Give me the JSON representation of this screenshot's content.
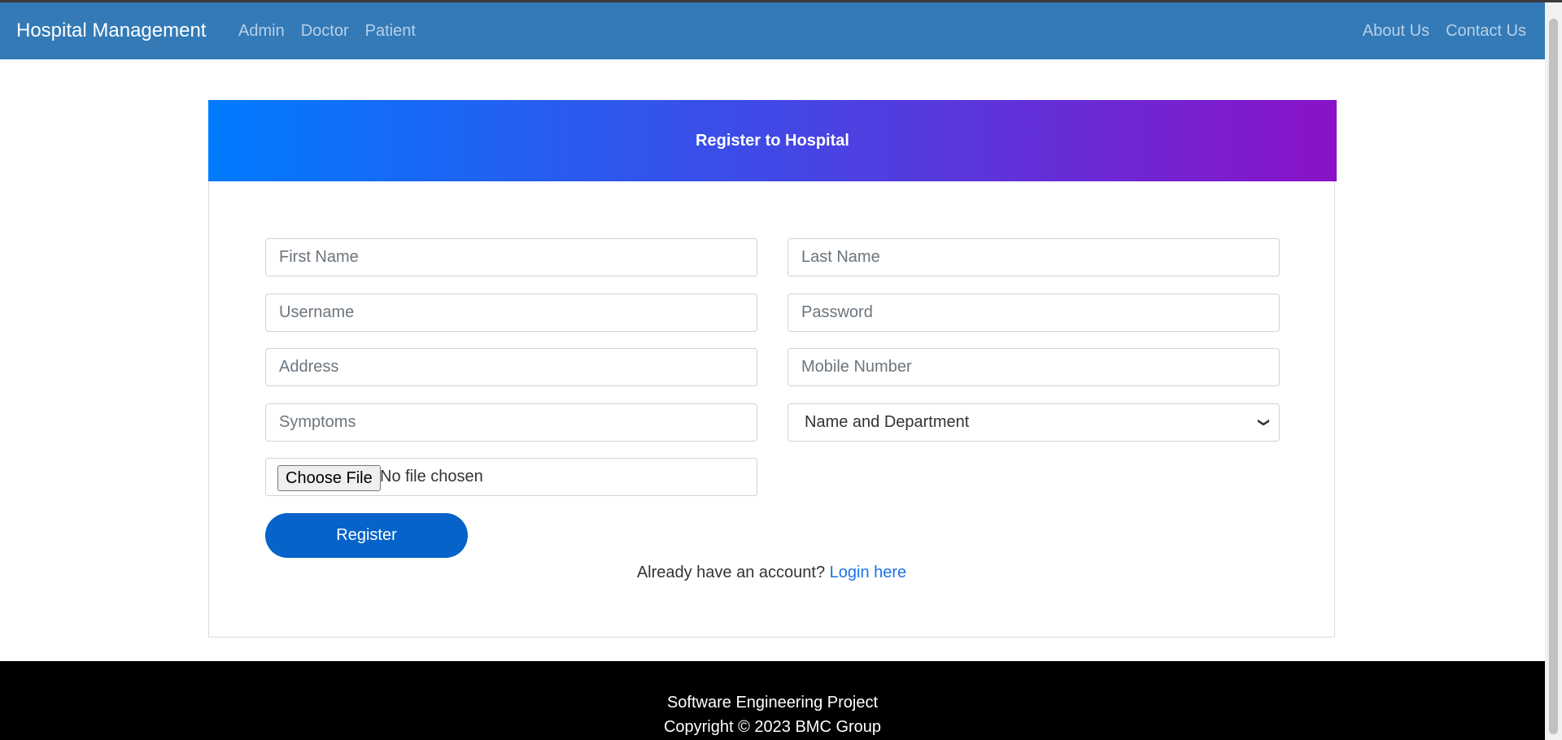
{
  "navbar": {
    "brand": "Hospital Management",
    "left_links": [
      "Admin",
      "Doctor",
      "Patient"
    ],
    "right_links": [
      "About Us",
      "Contact Us"
    ]
  },
  "form": {
    "title": "Register to Hospital",
    "first_name_placeholder": "First Name",
    "last_name_placeholder": "Last Name",
    "username_placeholder": "Username",
    "password_placeholder": "Password",
    "address_placeholder": "Address",
    "mobile_placeholder": "Mobile Number",
    "symptoms_placeholder": "Symptoms",
    "doctor_select_value": "Name and Department",
    "file_button_label": "Choose File",
    "file_status": "No file chosen",
    "register_label": "Register",
    "account_prompt": "Already have an account?",
    "login_link": "Login here"
  },
  "footer": {
    "line1": "Software Engineering Project",
    "line2": "Copyright © 2023 BMC Group"
  },
  "colors": {
    "navbar": "#337ab7",
    "header_gradient_start": "#007bff",
    "header_gradient_end": "#8a12c8",
    "register_button": "#0563c9",
    "footer": "#000000"
  }
}
